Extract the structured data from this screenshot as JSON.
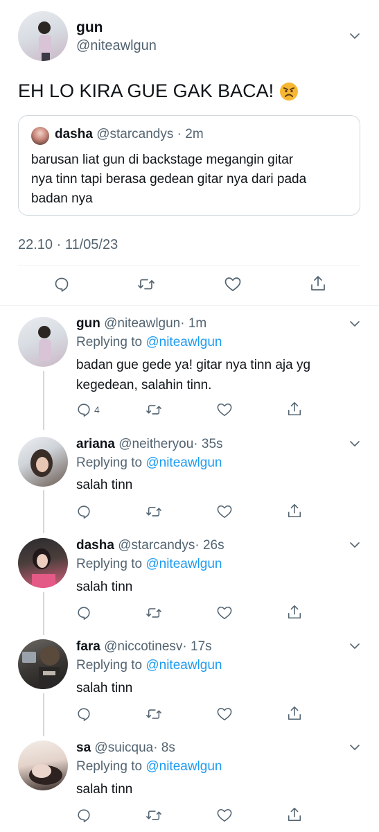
{
  "main_tweet": {
    "display_name": "gun",
    "handle": "@niteawlgun",
    "text": "EH LO KIRA GUE GAK BACA!",
    "emoji": "angry-face",
    "timestamp": "22.10 · 11/05/23",
    "quoted": {
      "display_name": "dasha",
      "handle": "@starcandys",
      "time": "· 2m",
      "text_lines": [
        "barusan liat gun di backstage megangin gitar",
        "nya tinn tapi berasa gedean gitar nya dari pada",
        "badan nya"
      ]
    }
  },
  "replying_prefix": "Replying to",
  "replies": [
    {
      "display_name": "gun",
      "handle": "@niteawlgun",
      "time": "· 1m",
      "replying_to": "@niteawlgun",
      "text_lines": [
        "badan gue gede ya! gitar nya tinn aja yg",
        "kegedean, salahin tinn."
      ],
      "reply_count": "4"
    },
    {
      "display_name": "ariana",
      "handle": "@neitheryou",
      "time": "· 35s",
      "replying_to": "@niteawlgun",
      "text_lines": [
        "salah tinn"
      ]
    },
    {
      "display_name": "dasha",
      "handle": "@starcandys",
      "time": "· 26s",
      "replying_to": "@niteawlgun",
      "text_lines": [
        "salah tinn"
      ]
    },
    {
      "display_name": "fara",
      "handle": "@niccotinesv",
      "time": "· 17s",
      "replying_to": "@niteawlgun",
      "text_lines": [
        "salah tinn"
      ]
    },
    {
      "display_name": "sa",
      "handle": "@suicqua",
      "time": "· 8s",
      "replying_to": "@niteawlgun",
      "text_lines": [
        "salah tinn"
      ]
    }
  ],
  "colors": {
    "accent": "#1d9bf0",
    "muted": "#536471",
    "divider": "#eff3f4",
    "thread_line": "#cfd9de"
  },
  "icons": [
    "reply-icon",
    "retweet-icon",
    "like-icon",
    "share-icon",
    "chevron-down-icon"
  ]
}
